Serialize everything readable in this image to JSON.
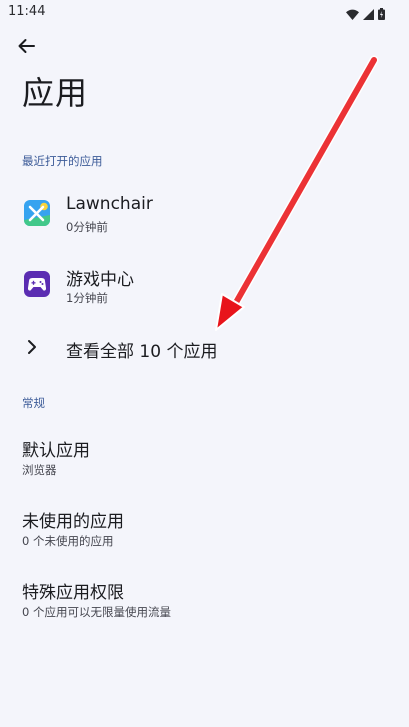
{
  "status_bar": {
    "time": "11:44"
  },
  "header": {
    "title": "应用"
  },
  "recent": {
    "section_label": "最近打开的应用",
    "apps": [
      {
        "name": "Lawnchair",
        "last_opened": "0分钟前",
        "icon": "lawnchair-icon"
      },
      {
        "name": "游戏中心",
        "last_opened": "1分钟前",
        "icon": "game-center-icon"
      }
    ],
    "see_all_label": "查看全部 10 个应用"
  },
  "general": {
    "section_label": "常规",
    "items": [
      {
        "title": "默认应用",
        "subtitle": "浏览器"
      },
      {
        "title": "未使用的应用",
        "subtitle": "0 个未使用的应用"
      },
      {
        "title": "特殊应用权限",
        "subtitle": "0 个应用可以无限量使用流量"
      }
    ]
  },
  "colors": {
    "accent": "#3c5b98",
    "background": "#f4f5fb",
    "annotation_arrow": "#e8141b"
  }
}
